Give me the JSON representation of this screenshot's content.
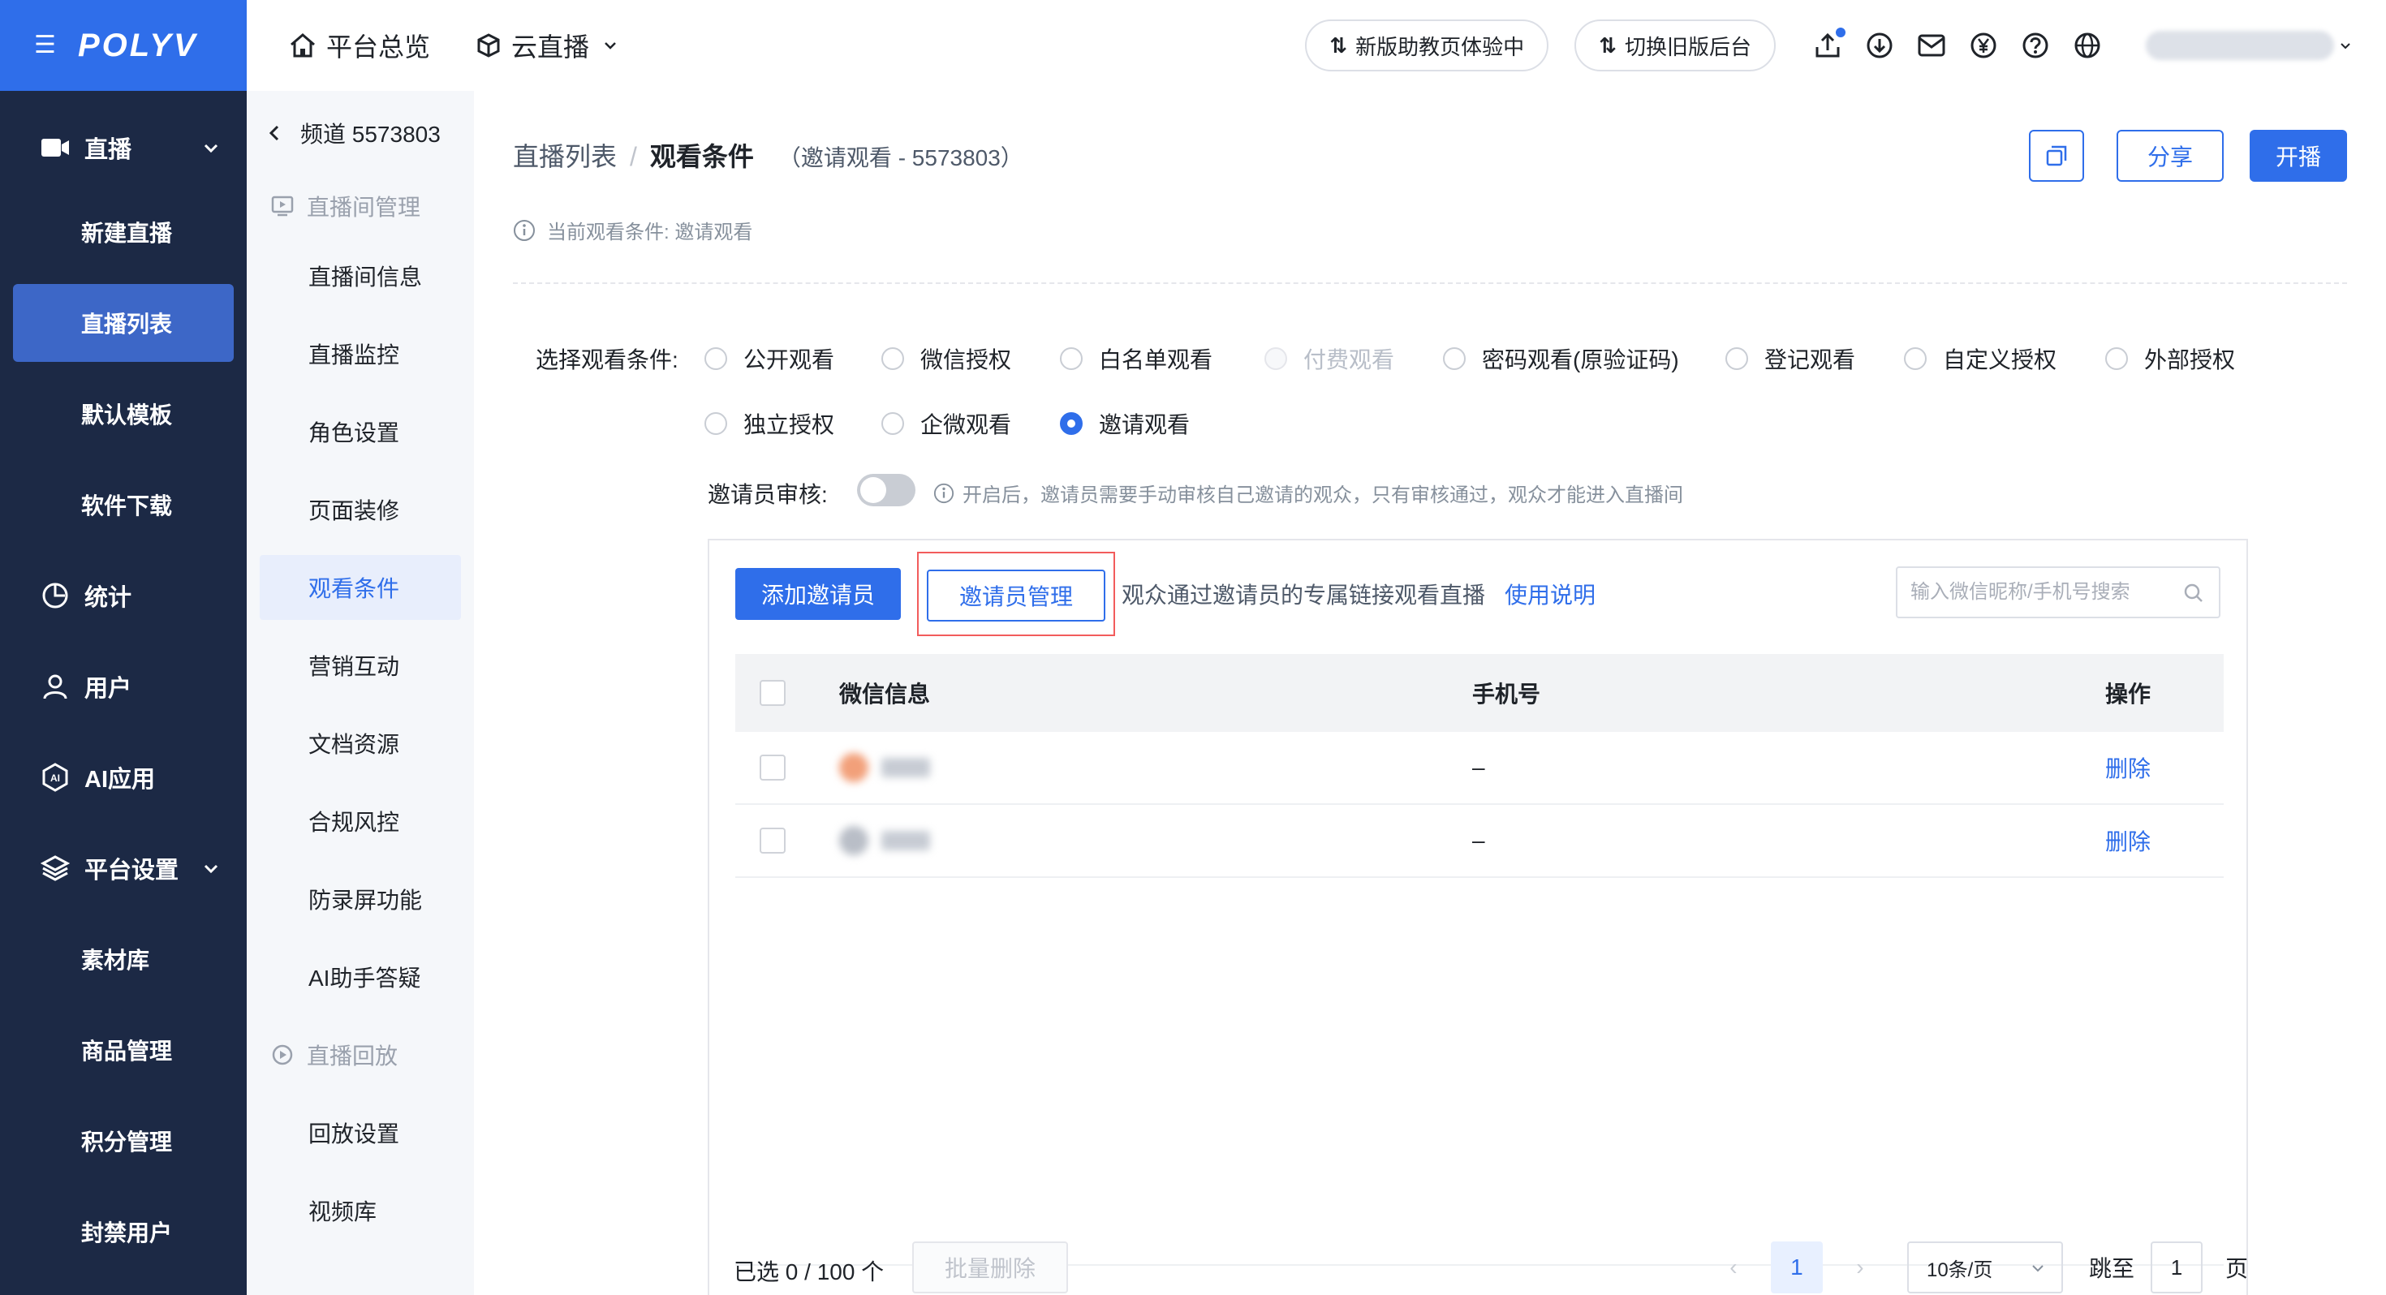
{
  "brand": {
    "logo_text": "POLYV",
    "accent": "#2f6eea",
    "sidebar_bg": "#1c2945"
  },
  "sidebar": {
    "groups": [
      {
        "label": "直播",
        "icon": "video-camera-icon"
      },
      {
        "label": "统计",
        "icon": "pie-chart-icon"
      },
      {
        "label": "用户",
        "icon": "user-icon"
      },
      {
        "label": "AI应用",
        "icon": "ai-icon"
      },
      {
        "label": "平台设置",
        "icon": "layers-icon"
      }
    ],
    "live_items": [
      "新建直播",
      "直播列表",
      "默认模板",
      "软件下载"
    ],
    "settings_items": [
      "素材库",
      "商品管理",
      "积分管理",
      "封禁用户"
    ]
  },
  "topbar": {
    "nav": [
      {
        "label": "平台总览",
        "icon": "home-icon"
      },
      {
        "label": "云直播",
        "icon": "cube-icon"
      }
    ],
    "pill_new": "新版助教页体验中",
    "pill_old": "切换旧版后台",
    "icons": [
      "upload-icon",
      "download-icon",
      "mail-icon",
      "yen-icon",
      "help-icon",
      "globe-icon"
    ]
  },
  "subnav": {
    "channel": "频道 5573803",
    "group_live": "直播间管理",
    "live_items": [
      "直播间信息",
      "直播监控",
      "角色设置",
      "页面装修",
      "观看条件",
      "营销互动",
      "文档资源",
      "合规风控",
      "防录屏功能",
      "AI助手答疑"
    ],
    "group_replay": "直播回放",
    "replay_items": [
      "回放设置",
      "视频库"
    ]
  },
  "main": {
    "breadcrumb": {
      "parent": "直播列表",
      "sep": "/",
      "current": "观看条件",
      "note": "（邀请观看 - 5573803）"
    },
    "actions": {
      "share": "分享",
      "start": "开播"
    },
    "current_condition": "当前观看条件: 邀请观看",
    "cond_label": "选择观看条件:",
    "radios": [
      {
        "label": "公开观看",
        "state": "normal"
      },
      {
        "label": "微信授权",
        "state": "normal"
      },
      {
        "label": "白名单观看",
        "state": "normal"
      },
      {
        "label": "付费观看",
        "state": "disabled"
      },
      {
        "label": "密码观看(原验证码)",
        "state": "normal"
      },
      {
        "label": "登记观看",
        "state": "normal"
      },
      {
        "label": "自定义授权",
        "state": "normal"
      },
      {
        "label": "外部授权",
        "state": "normal"
      },
      {
        "label": "独立授权",
        "state": "normal"
      },
      {
        "label": "企微观看",
        "state": "normal"
      },
      {
        "label": "邀请观看",
        "state": "checked"
      }
    ],
    "audit": {
      "label": "邀请员审核:",
      "enabled": false,
      "tip": "开启后，邀请员需要手动审核自己邀请的观众，只有审核通过，观众才能进入直播间"
    },
    "panel": {
      "add_btn": "添加邀请员",
      "manage_btn": "邀请员管理",
      "desc": "观众通过邀请员的专属链接观看直播",
      "help_link": "使用说明",
      "search_placeholder": "输入微信昵称/手机号搜索"
    },
    "table": {
      "headers": {
        "wx": "微信信息",
        "phone": "手机号",
        "op": "操作"
      },
      "rows": [
        {
          "phone": "–",
          "op": "删除"
        },
        {
          "phone": "–",
          "op": "删除"
        }
      ]
    },
    "footer": {
      "selected": "已选 0 / 100 个",
      "batch_delete": "批量删除",
      "page": "1",
      "page_size": "10条/页",
      "jump_label": "跳至",
      "jump_value": "1",
      "page_unit": "页"
    }
  }
}
